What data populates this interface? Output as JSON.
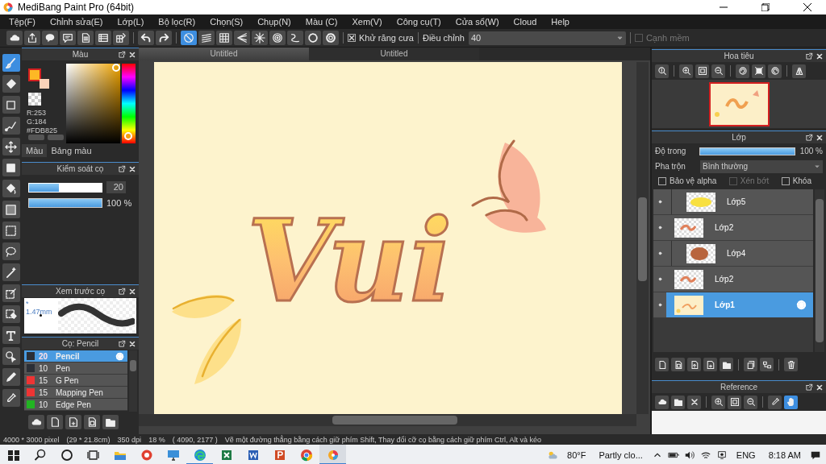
{
  "window": {
    "title": "MediBang Paint Pro (64bit)"
  },
  "menu": [
    "Tệp(F)",
    "Chỉnh sửa(E)",
    "Lớp(L)",
    "Bộ lọc(R)",
    "Chọn(S)",
    "Chụp(N)",
    "Màu (C)",
    "Xem(V)",
    "Công cụ(T)",
    "Cửa sổ(W)",
    "Cloud",
    "Help"
  ],
  "toolbar": {
    "snaps": [
      {
        "kind": "ban",
        "selected": true
      },
      {
        "kind": "parallel",
        "selected": false
      },
      {
        "kind": "grid",
        "selected": false
      },
      {
        "kind": "perspective",
        "selected": false
      },
      {
        "kind": "radial",
        "selected": false
      },
      {
        "kind": "concentric",
        "selected": false
      },
      {
        "kind": "curve",
        "selected": false
      },
      {
        "kind": "circle",
        "selected": false
      },
      {
        "kind": "gear",
        "selected": false
      }
    ],
    "antialias": {
      "label": "Khử răng cưa",
      "checked": true
    },
    "correction": {
      "label": "Điều chỉnh",
      "value": "40"
    },
    "soft_edge": {
      "label": "Cạnh mềm",
      "checked": false,
      "disabled": true
    }
  },
  "tools": [
    {
      "kind": "brush",
      "selected": true
    },
    {
      "kind": "eraser",
      "selected": false
    },
    {
      "kind": "dot",
      "selected": false
    },
    {
      "kind": "dotline",
      "selected": false
    },
    {
      "kind": "move",
      "selected": false
    },
    {
      "kind": "fill",
      "selected": false
    },
    {
      "kind": "bucket",
      "selected": false
    },
    {
      "kind": "gradient",
      "selected": false
    },
    {
      "kind": "selrect",
      "selected": false
    },
    {
      "kind": "lasso",
      "selected": false
    },
    {
      "kind": "wand",
      "selected": false
    },
    {
      "kind": "selpen",
      "selected": false
    },
    {
      "kind": "selerase",
      "selected": false
    },
    {
      "kind": "text",
      "selected": false
    },
    {
      "kind": "operation",
      "selected": false
    },
    {
      "kind": "pen",
      "selected": false
    },
    {
      "kind": "dropper",
      "selected": false
    }
  ],
  "color_panel": {
    "title": "Màu",
    "swatches": [
      {
        "color": "#fdb825",
        "selected": true
      },
      {
        "color": "#fbd3b9",
        "selected": false
      }
    ],
    "rgb": [
      "R:253",
      "G:184"
    ],
    "hex": "#FDB825",
    "tabs": [
      {
        "label": "Màu",
        "selected": true
      },
      {
        "label": "Bảng màu",
        "selected": false
      }
    ]
  },
  "brush_control": {
    "title": "Kiểm soát cọ",
    "size": {
      "level": 0.41,
      "value": "20"
    },
    "opacity": {
      "level": 1,
      "reading": "100 %"
    }
  },
  "brush_preview": {
    "title": "Xem trước cọ",
    "size": "* 1.47mm"
  },
  "brush_list": {
    "title": "Cọ: Pencil",
    "items": [
      {
        "size": "20",
        "name": "Pencil",
        "color": "#2b2f36",
        "selected": true
      },
      {
        "size": "10",
        "name": "Pen",
        "color": "#2b2f36",
        "selected": false
      },
      {
        "size": "15",
        "name": "G Pen",
        "color": "#ee3434",
        "selected": false
      },
      {
        "size": "15",
        "name": "Mapping Pen",
        "color": "#ee3434",
        "selected": false
      },
      {
        "size": "10",
        "name": "Edge Pen",
        "color": "#22b422",
        "selected": false
      }
    ]
  },
  "document_tabs": [
    {
      "label": "Untitled",
      "selected": true
    },
    {
      "label": "Untitled",
      "selected": false
    }
  ],
  "artwork": {
    "text": "Vui"
  },
  "navigator": {
    "title": "Hoa tiêu"
  },
  "layers": {
    "title": "Lớp",
    "opacity_label": "Độ trong",
    "opacity": {
      "level": 1,
      "reading": "100 %"
    },
    "blend_label": "Pha trộn",
    "blend": "Bình thường",
    "options": [
      {
        "label": "Bảo vệ alpha",
        "checked": false,
        "disabled": false
      },
      {
        "label": "Xén bớt",
        "checked": false,
        "disabled": true
      },
      {
        "label": "Khóa",
        "checked": false,
        "disabled": false
      }
    ],
    "items": [
      {
        "name": "Lớp5",
        "kind": "yellow-blob",
        "clipped": true,
        "selected": false
      },
      {
        "name": "Lớp2",
        "kind": "lettering",
        "clipped": false,
        "selected": false
      },
      {
        "name": "Lớp4",
        "kind": "brown-blob",
        "clipped": true,
        "selected": false
      },
      {
        "name": "Lớp2",
        "kind": "lettering",
        "clipped": false,
        "selected": false
      },
      {
        "name": "Lớp1",
        "kind": "artwork",
        "clipped": false,
        "selected": true
      }
    ]
  },
  "reference": {
    "title": "Reference"
  },
  "status_bar": [
    "4000 * 3000 pixel",
    "(29 * 21.8cm)",
    "350 dpi",
    "18 %",
    "( 4090, 2177 )",
    "Vẽ một đường thẳng bằng cách giữ phím Shift, Thay đổi cỡ cọ bằng cách giữ phím Ctrl, Alt và kéo"
  ],
  "taskbar": {
    "apps": [
      {
        "kind": "explorer",
        "open": false,
        "selected": false
      },
      {
        "kind": "redapp",
        "open": false,
        "selected": false
      },
      {
        "kind": "monitor",
        "open": false,
        "selected": false
      },
      {
        "kind": "edge",
        "open": true,
        "selected": false
      },
      {
        "kind": "excel",
        "open": false,
        "selected": false
      },
      {
        "kind": "word",
        "open": false,
        "selected": false
      },
      {
        "kind": "powerpoint",
        "open": false,
        "selected": false
      },
      {
        "kind": "chrome",
        "open": false,
        "selected": false
      },
      {
        "kind": "medibang",
        "open": true,
        "selected": true
      }
    ],
    "temperature": "80°F",
    "weather": "Partly clo...",
    "language": "ENG",
    "time": "8:18 AM"
  }
}
